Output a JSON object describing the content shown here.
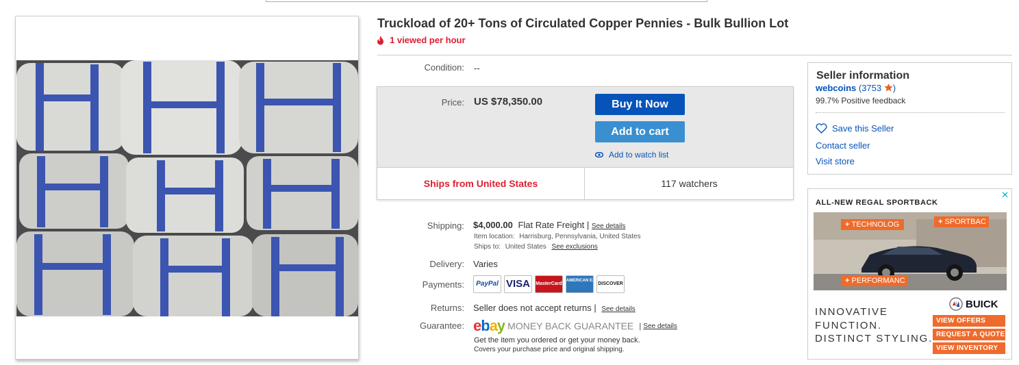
{
  "listing": {
    "title": "Truckload of 20+ Tons of Circulated Copper Pennies - Bulk Bullion Lot",
    "views": "1 viewed per hour",
    "condition_label": "Condition:",
    "condition_value": "--",
    "price_label": "Price:",
    "price_value": "US $78,350.00",
    "buy_now": "Buy It Now",
    "add_to_cart": "Add to cart",
    "watch_list": "Add to watch list",
    "ships_from": "Ships from United States",
    "watchers": "117 watchers"
  },
  "shipping": {
    "label": "Shipping:",
    "amount": "$4,000.00",
    "method": "Flat Rate Freight |",
    "see_details": "See details",
    "item_location_label": "Item location:",
    "item_location": "Harrisburg, Pennsylvania, United States",
    "ships_to_label": "Ships to:",
    "ships_to": "United States",
    "see_exclusions": "See exclusions"
  },
  "delivery": {
    "label": "Delivery:",
    "value": "Varies"
  },
  "payments": {
    "label": "Payments:",
    "cards": [
      {
        "name": "PayPal",
        "bg": "#ffffff",
        "fg": "#1a4b96"
      },
      {
        "name": "VISA",
        "bg": "#ffffff",
        "fg": "#1a1f71"
      },
      {
        "name": "MasterCard",
        "bg": "#c7151d",
        "fg": "#ffffff"
      },
      {
        "name": "AMERICAN EXPRESS",
        "bg": "#2e77bc",
        "fg": "#ffffff"
      },
      {
        "name": "DISCOVER",
        "bg": "#ffffff",
        "fg": "#222222"
      }
    ]
  },
  "returns": {
    "label": "Returns:",
    "value": "Seller does not accept returns |",
    "see_details": "See details"
  },
  "guarantee": {
    "label": "Guarantee:",
    "logo_text": "ebay",
    "mbg_text": "MONEY BACK GUARANTEE",
    "see_details": "See details",
    "line1": "Get the item you ordered or get your money back.",
    "line2": "Covers your purchase price and original shipping."
  },
  "seller": {
    "title": "Seller information",
    "name": "webcoins",
    "open": " (",
    "count": "3753",
    "close": ")",
    "feedback": "99.7% Positive feedback",
    "save": "Save this Seller",
    "contact": "Contact seller",
    "visit": "Visit store"
  },
  "ad": {
    "close": "✕",
    "headline": "ALL-NEW REGAL SPORTBACK",
    "tags": [
      "TECHNOLOG",
      "SPORTBAC",
      "PERFORMANC"
    ],
    "slogan": [
      "INNOVATIVE",
      "FUNCTION.",
      "DISTINCT STYLING."
    ],
    "brand": "BUICK",
    "buttons": [
      "VIEW OFFERS",
      "REQUEST A QUOTE",
      "VIEW INVENTORY"
    ]
  },
  "colors": {
    "accent_blue": "#0654ba",
    "cart_blue": "#3a8fd1",
    "alert_red": "#dd1e31",
    "ad_orange": "#ef6b2c"
  }
}
